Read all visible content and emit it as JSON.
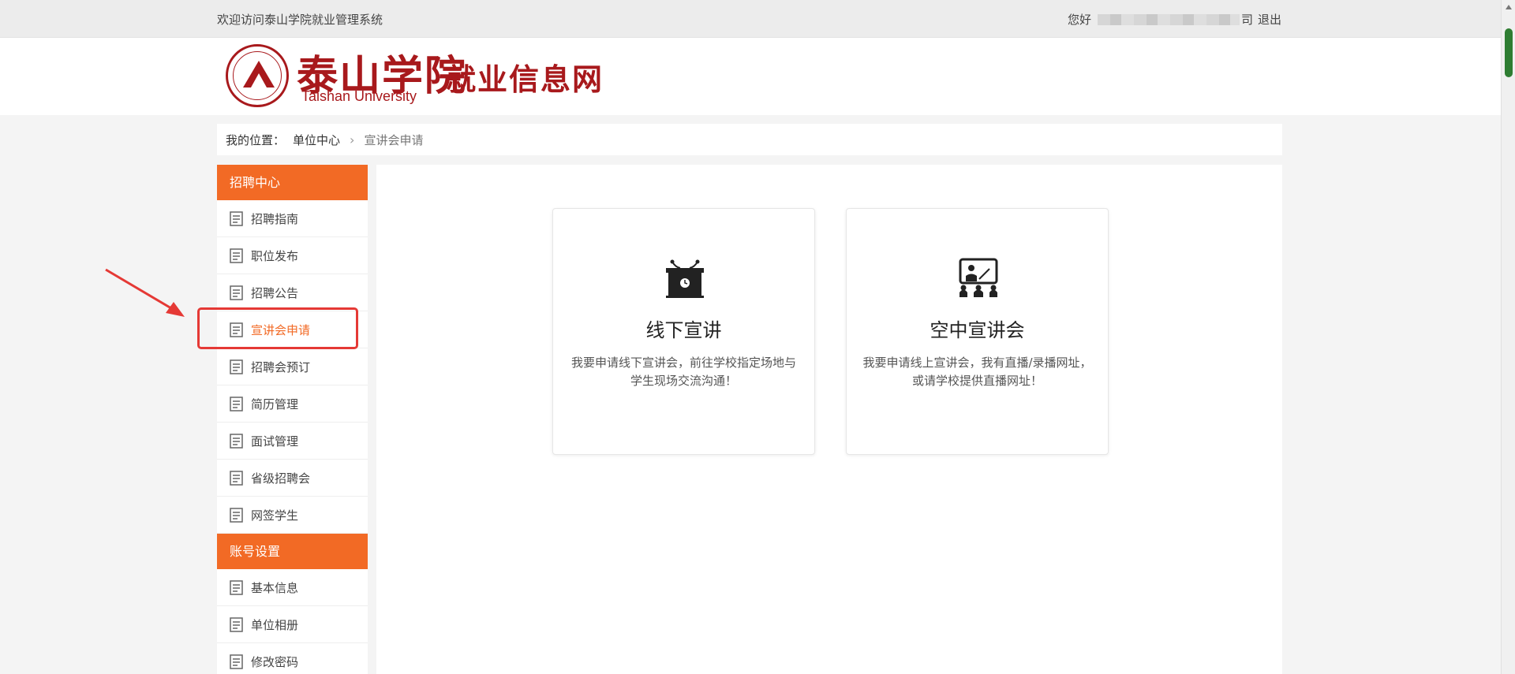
{
  "topbar": {
    "welcome": "欢迎访问泰山学院就业管理系统",
    "greeting": "您好",
    "company_suffix": "司",
    "logout": "退出"
  },
  "header": {
    "logo_cn": "泰山学院",
    "logo_en": "Taishan University",
    "site_name": "就业信息网"
  },
  "breadcrumb": {
    "label": "我的位置：",
    "home": "单位中心",
    "current": "宣讲会申请"
  },
  "sidebar": {
    "sections": [
      {
        "title": "招聘中心",
        "items": [
          {
            "label": "招聘指南"
          },
          {
            "label": "职位发布"
          },
          {
            "label": "招聘公告"
          },
          {
            "label": "宣讲会申请",
            "active": true
          },
          {
            "label": "招聘会预订"
          },
          {
            "label": "简历管理"
          },
          {
            "label": "面试管理"
          },
          {
            "label": "省级招聘会"
          },
          {
            "label": "网签学生"
          }
        ]
      },
      {
        "title": "账号设置",
        "items": [
          {
            "label": "基本信息"
          },
          {
            "label": "单位相册"
          },
          {
            "label": "修改密码"
          }
        ]
      }
    ]
  },
  "cards": [
    {
      "icon": "podium-icon",
      "title": "线下宣讲",
      "desc": "我要申请线下宣讲会，前往学校指定场地与学生现场交流沟通！"
    },
    {
      "icon": "presentation-screen-icon",
      "title": "空中宣讲会",
      "desc": "我要申请线上宣讲会，我有直播/录播网址，或请学校提供直播网址！"
    }
  ],
  "colors": {
    "accent": "#f26a25",
    "brand": "#a8191c",
    "annotation": "#e53935"
  }
}
